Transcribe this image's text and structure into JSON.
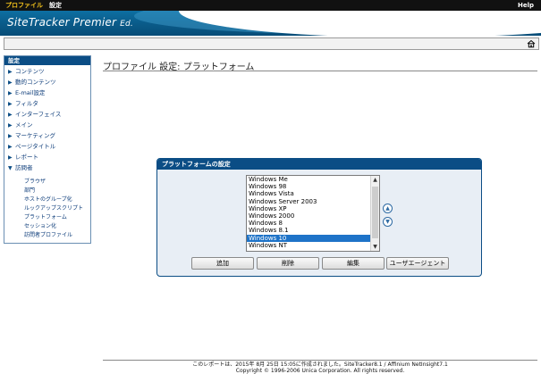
{
  "menubar": {
    "profile": "プロファイル",
    "settings": "設定",
    "help": "Help"
  },
  "banner": {
    "logo": "SiteTracker Premier",
    "edition": "Ed."
  },
  "toolbar": {
    "home_icon": "home-icon"
  },
  "sidebar": {
    "header": "設定",
    "items": [
      {
        "label": "コンテンツ",
        "expanded": false
      },
      {
        "label": "動的コンテンツ",
        "expanded": false
      },
      {
        "label": "E-mail設定",
        "expanded": false
      },
      {
        "label": "フィルタ",
        "expanded": false
      },
      {
        "label": "インターフェイス",
        "expanded": false
      },
      {
        "label": "メイン",
        "expanded": false
      },
      {
        "label": "マーケティング",
        "expanded": false
      },
      {
        "label": "ページタイトル",
        "expanded": false
      },
      {
        "label": "レポート",
        "expanded": false
      },
      {
        "label": "訪問者",
        "expanded": true
      }
    ],
    "subitems": [
      "ブラウザ",
      "部門",
      "ホストのグループ化",
      "ルックアップスクリプト",
      "プラットフォーム",
      "セッション化",
      "訪問者プロファイル"
    ]
  },
  "page": {
    "title": "プロファイル 設定: プラットフォーム"
  },
  "panel": {
    "title": "プラットフォームの設定",
    "options": [
      "Windows Me",
      "Windows 98",
      "Windows Vista",
      "Windows Server 2003",
      "Windows XP",
      "Windows 2000",
      "Windows 8",
      "Windows 8.1",
      "Windows 10",
      "Windows NT"
    ],
    "selected": "Windows 10",
    "buttons": {
      "add": "追加",
      "delete": "削除",
      "edit": "編集",
      "user_agent": "ユーザエージェント"
    }
  },
  "footer": {
    "line1": "このレポートは、2015年 8月 25日 15:05に作成されました。SiteTracker8.1 / Affinium NetInsight7.1",
    "line2": "Copyright © 1996-2006 Unica Corporation. All rights reserved."
  },
  "colors": {
    "accent": "#0b4d85",
    "menu_active": "#f4c21b",
    "selection": "#1e73c8"
  }
}
